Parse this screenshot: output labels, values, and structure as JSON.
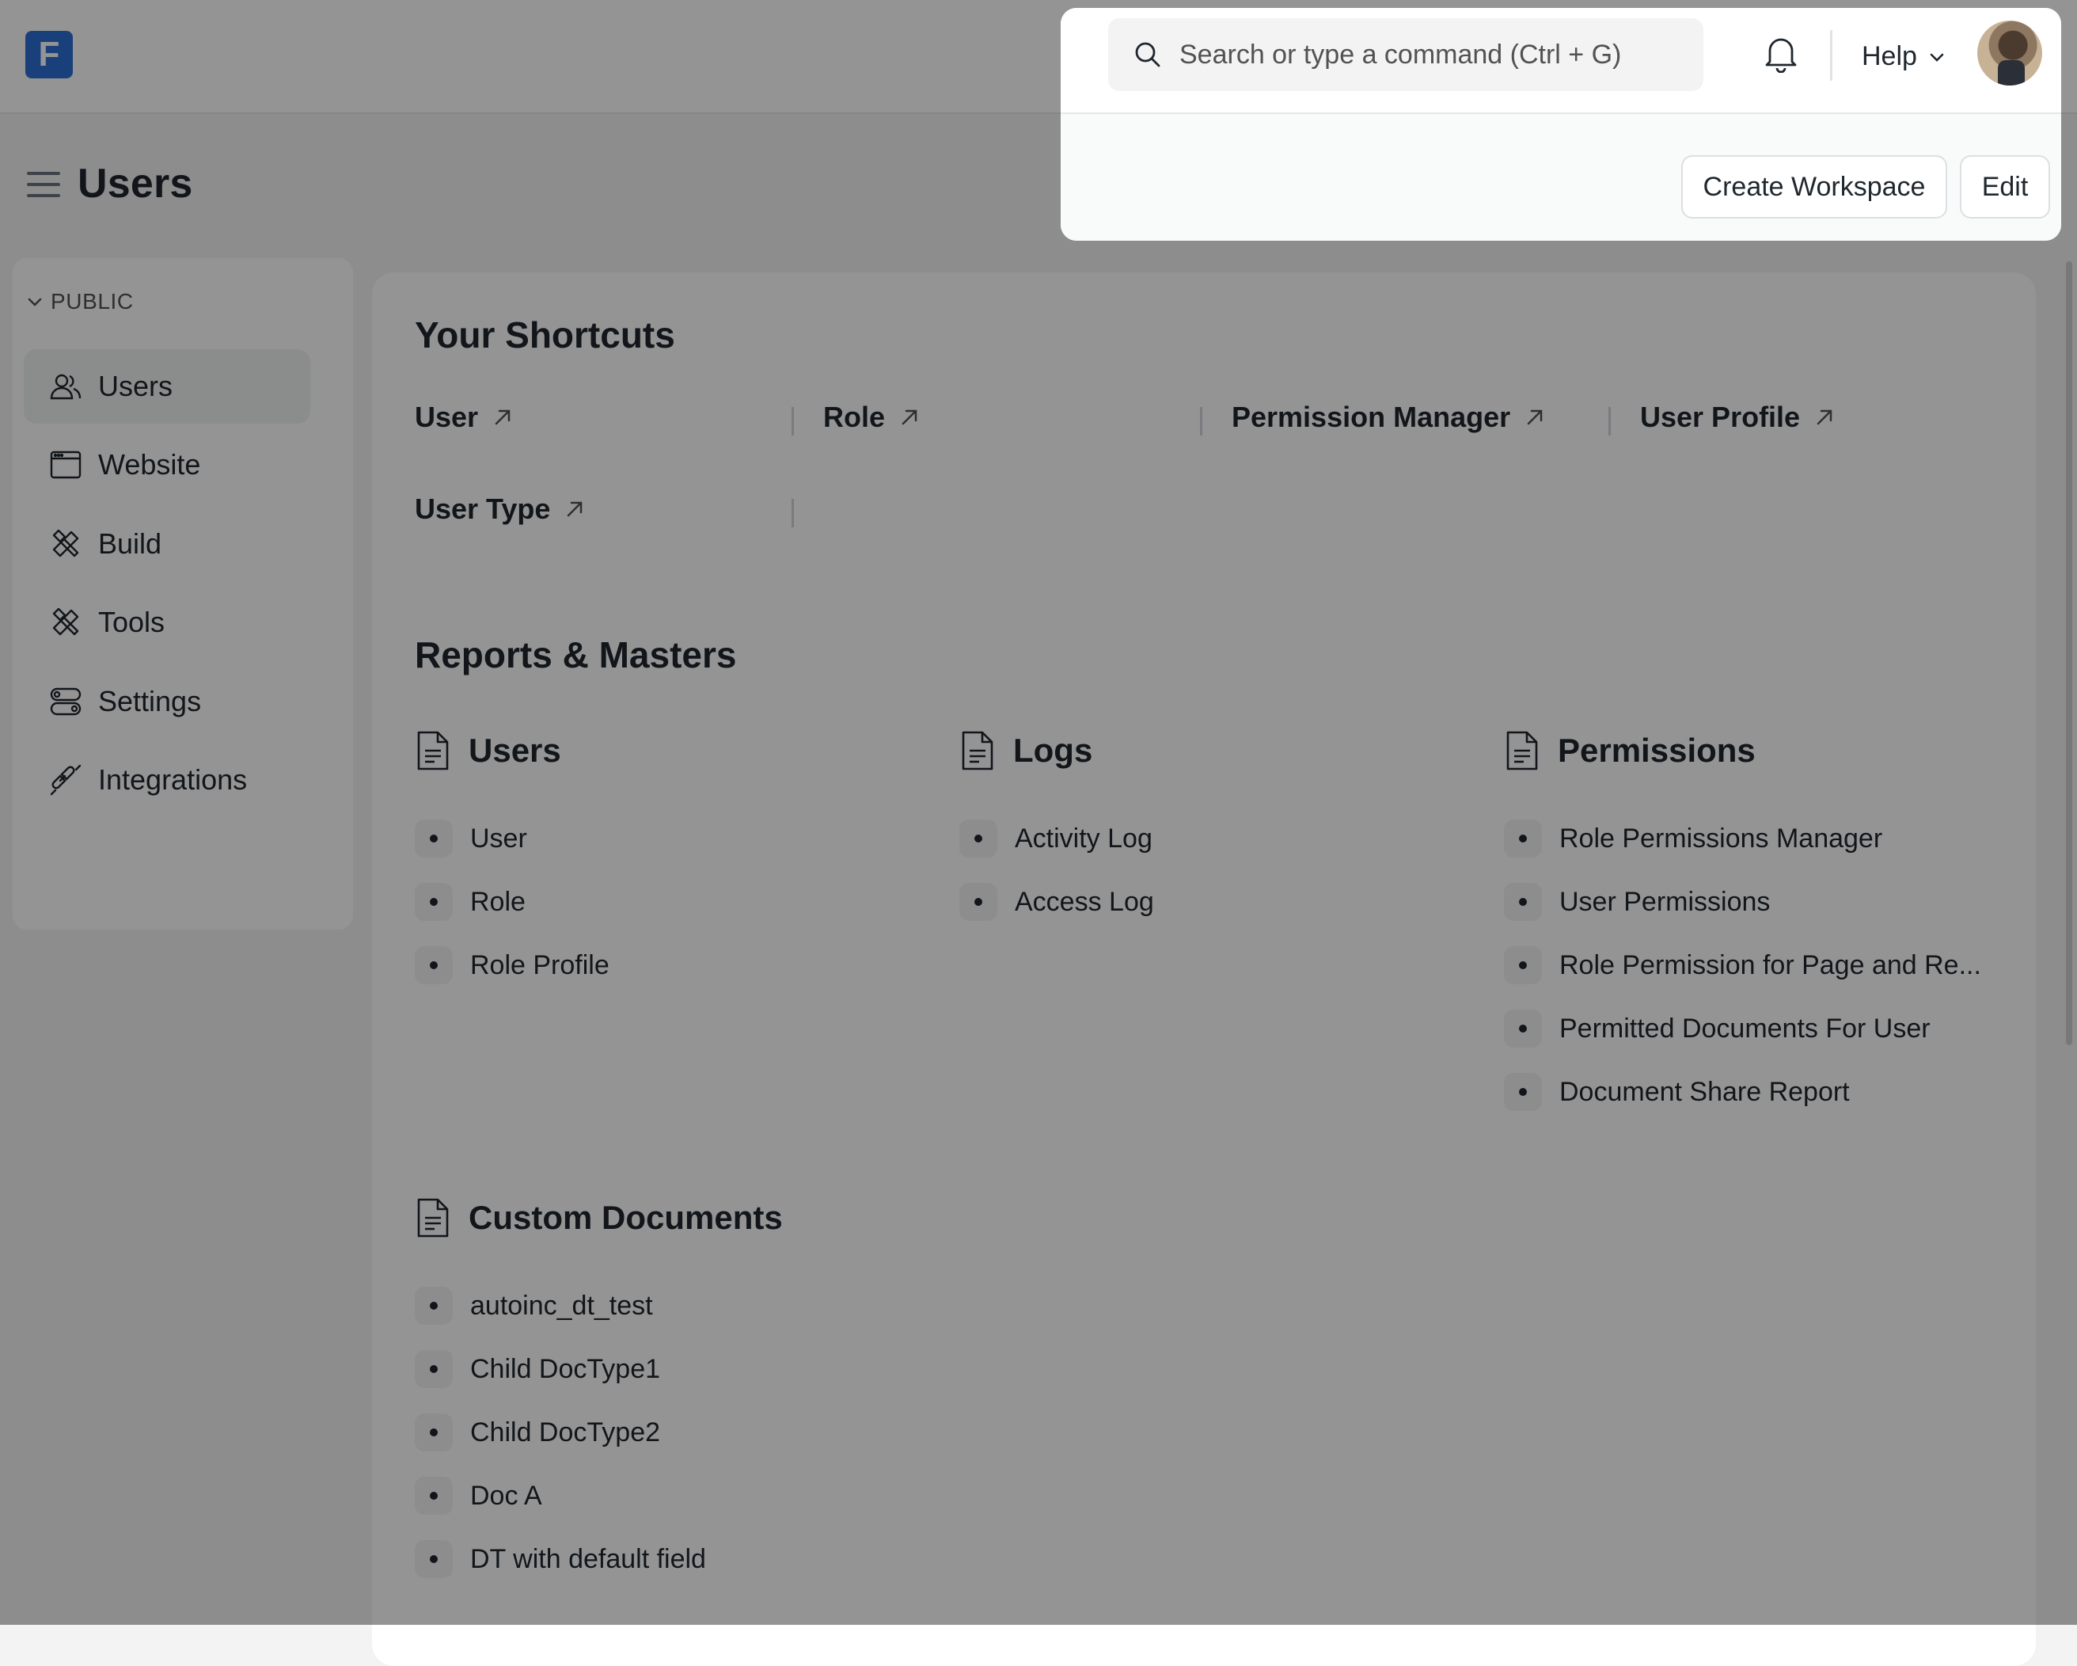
{
  "navbar": {
    "logo_letter": "F",
    "search_placeholder": "Search or type a command (Ctrl + G)",
    "help_label": "Help"
  },
  "page": {
    "title": "Users",
    "actions": {
      "create_workspace": "Create Workspace",
      "edit": "Edit"
    }
  },
  "sidebar": {
    "section_label": "PUBLIC",
    "items": [
      {
        "label": "Users",
        "icon": "users-icon",
        "active": true
      },
      {
        "label": "Website",
        "icon": "website-icon"
      },
      {
        "label": "Build",
        "icon": "build-icon"
      },
      {
        "label": "Tools",
        "icon": "tools-icon"
      },
      {
        "label": "Settings",
        "icon": "settings-icon"
      },
      {
        "label": "Integrations",
        "icon": "integrations-icon"
      }
    ]
  },
  "shortcuts": {
    "heading": "Your Shortcuts",
    "items": [
      "User",
      "Role",
      "Permission Manager",
      "User Profile",
      "User Type"
    ]
  },
  "reports": {
    "heading": "Reports & Masters",
    "cards": [
      {
        "title": "Users",
        "links": [
          "User",
          "Role",
          "Role Profile"
        ]
      },
      {
        "title": "Logs",
        "links": [
          "Activity Log",
          "Access Log"
        ]
      },
      {
        "title": "Permissions",
        "links": [
          "Role Permissions Manager",
          "User Permissions",
          "Role Permission for Page and Re...",
          "Permitted Documents For User",
          "Document Share Report"
        ]
      },
      {
        "title": "Custom Documents",
        "links": [
          "autoinc_dt_test",
          "Child DocType1",
          "Child DocType2",
          "Doc A",
          "DT with default field"
        ]
      }
    ]
  },
  "colors": {
    "brand": "#2d6fd6",
    "overlay": "rgba(0,0,0,0.42)"
  }
}
